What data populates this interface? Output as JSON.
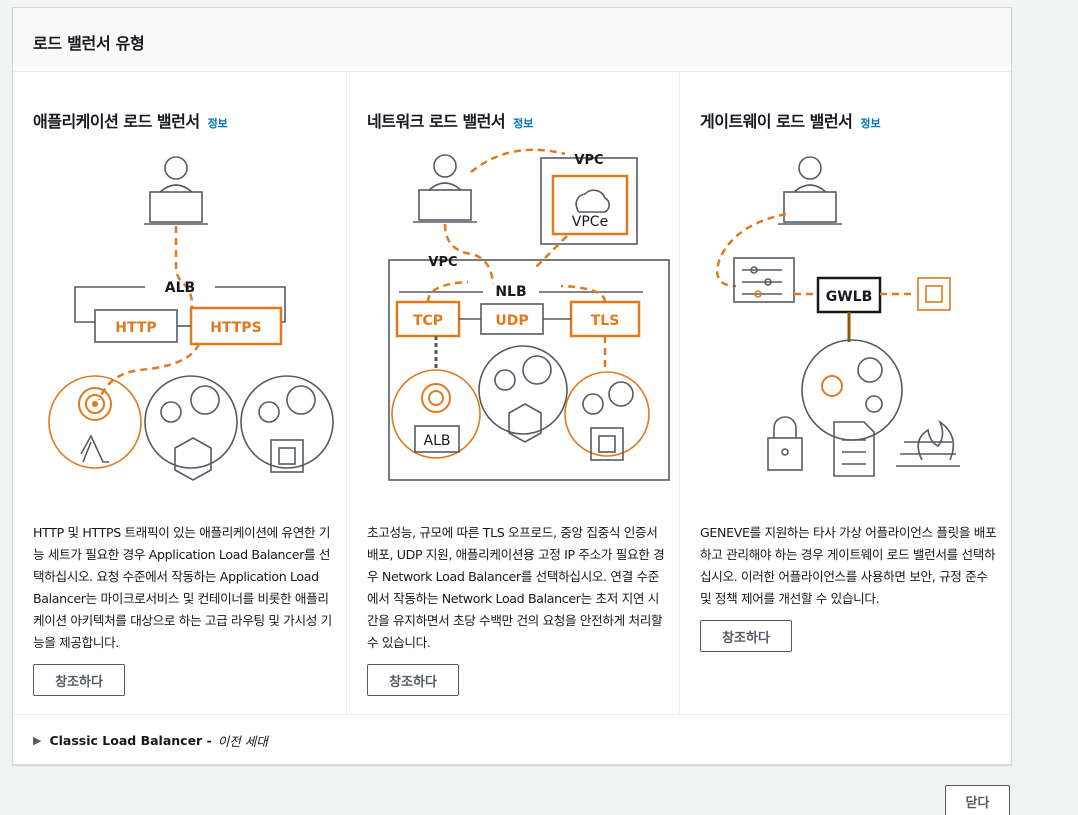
{
  "header": {
    "title": "로드 밸런서 유형"
  },
  "cards": [
    {
      "title": "애플리케이션 로드 밸런서",
      "info_label": "정보",
      "diagram_labels": {
        "group": "ALB",
        "left_box": "HTTP",
        "right_box": "HTTPS"
      },
      "description": "HTTP 및 HTTPS 트래픽이 있는 애플리케이션에 유연한 기능 세트가 필요한 경우 Application Load Balancer를 선택하십시오. 요청 수준에서 작동하는 Application Load Balancer는 마이크로서비스 및 컨테이너를 비롯한 애플리케이션 아키텍처를 대상으로 하는 고급 라우팅 및 가시성 기능을 제공합니다.",
      "button_label": "창조하다"
    },
    {
      "title": "네트워크 로드 밸런서",
      "info_label": "정보",
      "diagram_labels": {
        "vpc_top": "VPC",
        "vpce": "VPCe",
        "vpc": "VPC",
        "group": "NLB",
        "tcp": "TCP",
        "udp": "UDP",
        "tls": "TLS",
        "alb": "ALB"
      },
      "description": "초고성능, 규모에 따른 TLS 오프로드, 중앙 집중식 인증서 배포, UDP 지원, 애플리케이션용 고정 IP 주소가 필요한 경우 Network Load Balancer를 선택하십시오. 연결 수준에서 작동하는 Network Load Balancer는 초저 지연 시간을 유지하면서 초당 수백만 건의 요청을 안전하게 처리할 수 있습니다.",
      "button_label": "창조하다"
    },
    {
      "title": "게이트웨이 로드 밸런서",
      "info_label": "정보",
      "diagram_labels": {
        "gwlb": "GWLB"
      },
      "description": "GENEVE를 지원하는 타사 가상 어플라이언스 플릿을 배포하고 관리해야 하는 경우 게이트웨이 로드 밸런서를 선택하십시오. 이러한 어플라이언스를 사용하면 보안, 규정 준수 및 정책 제어를 개선할 수 있습니다.",
      "button_label": "창조하다"
    }
  ],
  "classic": {
    "label": "Classic Load Balancer -",
    "sublabel": "이전 세대"
  },
  "footer": {
    "close_label": "닫다"
  },
  "colors": {
    "accent": "#e07a1f",
    "link": "#0073bb",
    "text": "#16191f",
    "border": "#545b64"
  }
}
